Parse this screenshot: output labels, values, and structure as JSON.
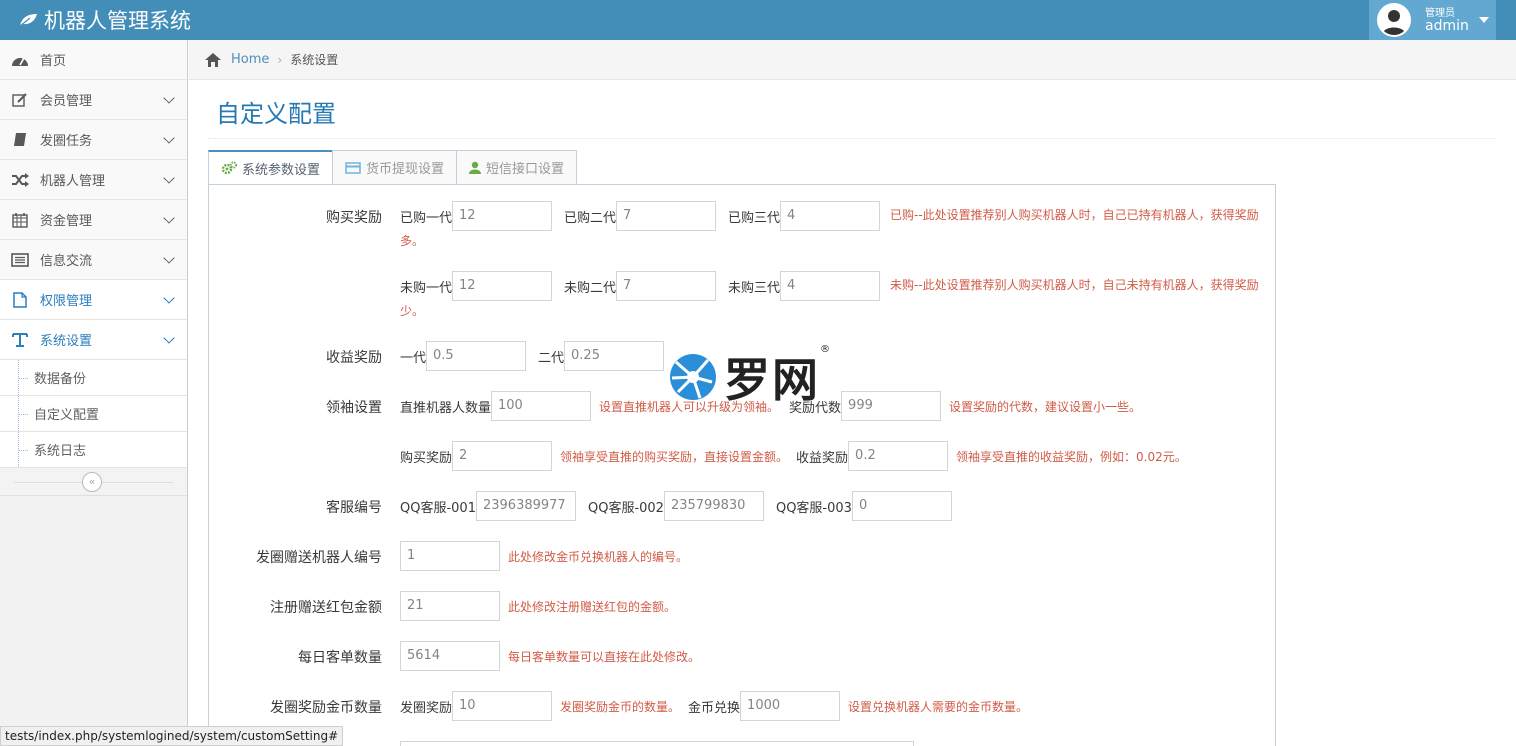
{
  "app": {
    "title": "机器人管理系统"
  },
  "user": {
    "role": "管理员",
    "name": "admin"
  },
  "sidebar": {
    "items": [
      {
        "label": "首页"
      },
      {
        "label": "会员管理"
      },
      {
        "label": "发圈任务"
      },
      {
        "label": "机器人管理"
      },
      {
        "label": "资金管理"
      },
      {
        "label": "信息交流"
      },
      {
        "label": "权限管理"
      },
      {
        "label": "系统设置"
      }
    ],
    "sub_items": [
      {
        "label": "数据备份"
      },
      {
        "label": "自定义配置"
      },
      {
        "label": "系统日志"
      }
    ],
    "collapse_glyph": "«"
  },
  "breadcrumb": {
    "home": "Home",
    "current": "系统设置"
  },
  "page": {
    "title": "自定义配置"
  },
  "tabs": [
    {
      "label": "系统参数设置"
    },
    {
      "label": "货币提现设置"
    },
    {
      "label": "短信接口设置"
    }
  ],
  "form": {
    "buy_reward": {
      "label": "购买奖励",
      "bought": [
        {
          "label": "已购一代",
          "value": "12"
        },
        {
          "label": "已购二代",
          "value": "7"
        },
        {
          "label": "已购三代",
          "value": "4"
        }
      ],
      "bought_note": "已购--此处设置推荐别人购买机器人时，自己已持有机器人，获得奖励多。",
      "unbought": [
        {
          "label": "未购一代",
          "value": "12"
        },
        {
          "label": "未购二代",
          "value": "7"
        },
        {
          "label": "未购三代",
          "value": "4"
        }
      ],
      "unbought_note": "未购--此处设置推荐别人购买机器人时，自己未持有机器人，获得奖励少。"
    },
    "income_reward": {
      "label": "收益奖励",
      "items": [
        {
          "label": "一代",
          "value": "0.5"
        },
        {
          "label": "二代",
          "value": "0.25"
        }
      ]
    },
    "leader": {
      "label": "领袖设置",
      "direct_label": "直推机器人数量",
      "direct_value": "100",
      "direct_note": "设置直推机器人可以升级为领袖。",
      "gen_label": "奖励代数",
      "gen_value": "999",
      "gen_note": "设置奖励的代数，建议设置小一些。",
      "buy_label": "购买奖励",
      "buy_value": "2",
      "buy_note": "领袖享受直推的购买奖励，直接设置金额。",
      "income_label": "收益奖励",
      "income_value": "0.2",
      "income_note": "领袖享受直推的收益奖励，例如：0.02元。"
    },
    "service": {
      "label": "客服编号",
      "items": [
        {
          "label": "QQ客服-001",
          "value": "2396389977"
        },
        {
          "label": "QQ客服-002",
          "value": "235799830"
        },
        {
          "label": "QQ客服-003",
          "value": "0"
        }
      ]
    },
    "gift_robot": {
      "label": "发圈赠送机器人编号",
      "value": "1",
      "note": "此处修改金币兑换机器人的编号。"
    },
    "register_gift": {
      "label": "注册赠送红包金额",
      "value": "21",
      "note": "此处修改注册赠送红包的金额。"
    },
    "daily_orders": {
      "label": "每日客单数量",
      "value": "5614",
      "note": "每日客单数量可以直接在此处修改。"
    },
    "coin_reward": {
      "label": "发圈奖励金币数量",
      "reward_label": "发圈奖励",
      "reward_value": "10",
      "reward_note": "发圈奖励金币的数量。",
      "exchange_label": "金币兑换",
      "exchange_value": "1000",
      "exchange_note": "设置兑换机器人需要的金币数量。"
    }
  },
  "watermark": {
    "text": "罗网",
    "mark": "®"
  },
  "status_url": "tests/index.php/systemlogined/system/customSetting#",
  "colors": {
    "navbar": "#438eb9",
    "title": "#2679b5",
    "note": "#d15b47"
  }
}
